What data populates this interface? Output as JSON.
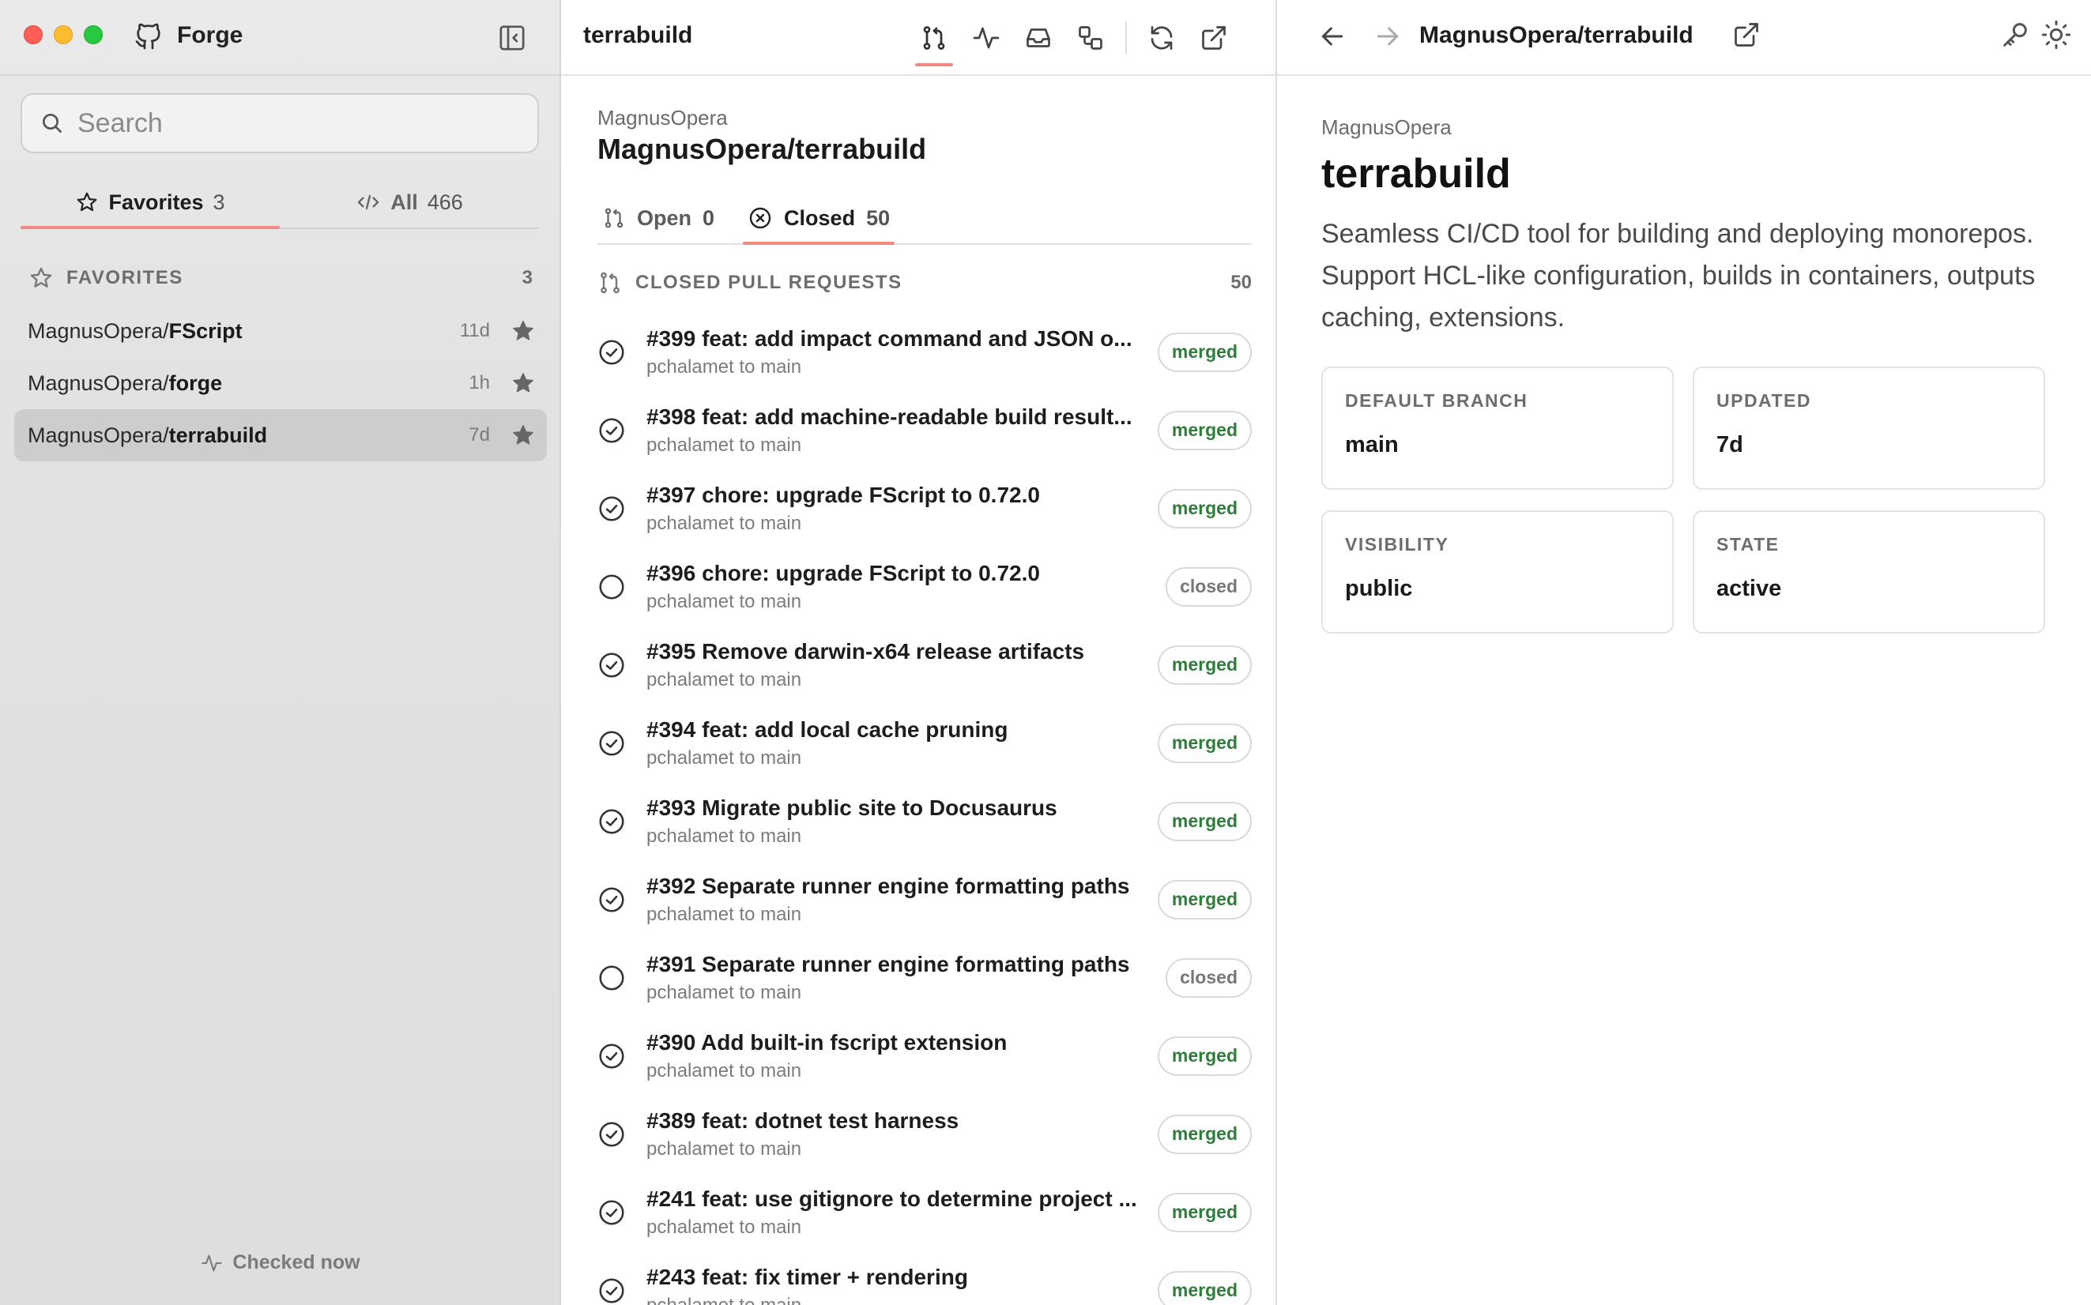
{
  "app": {
    "name": "Forge"
  },
  "sidebar": {
    "search_placeholder": "Search",
    "tabs": [
      {
        "label": "Favorites",
        "count": "3"
      },
      {
        "label": "All",
        "count": "466"
      }
    ],
    "favorites_header": {
      "title": "FAVORITES",
      "count": "3"
    },
    "repos": [
      {
        "owner": "MagnusOpera/",
        "name": "FScript",
        "age": "11d"
      },
      {
        "owner": "MagnusOpera/",
        "name": "forge",
        "age": "1h"
      },
      {
        "owner": "MagnusOpera/",
        "name": "terrabuild",
        "age": "7d"
      }
    ],
    "status": "Checked now"
  },
  "middle": {
    "title": "terrabuild",
    "owner": "MagnusOpera",
    "repo": "MagnusOpera/terrabuild",
    "tabs": [
      {
        "label": "Open",
        "count": "0"
      },
      {
        "label": "Closed",
        "count": "50"
      }
    ],
    "list_header": {
      "title": "CLOSED PULL REQUESTS",
      "count": "50"
    },
    "pull_requests": [
      {
        "title": "#399 feat: add impact command and JSON o...",
        "sub": "pchalamet to main",
        "status": "merged"
      },
      {
        "title": "#398 feat: add machine-readable build result...",
        "sub": "pchalamet to main",
        "status": "merged"
      },
      {
        "title": "#397 chore: upgrade FScript to 0.72.0",
        "sub": "pchalamet to main",
        "status": "merged"
      },
      {
        "title": "#396 chore: upgrade FScript to 0.72.0",
        "sub": "pchalamet to main",
        "status": "closed"
      },
      {
        "title": "#395 Remove darwin-x64 release artifacts",
        "sub": "pchalamet to main",
        "status": "merged"
      },
      {
        "title": "#394 feat: add local cache pruning",
        "sub": "pchalamet to main",
        "status": "merged"
      },
      {
        "title": "#393 Migrate public site to Docusaurus",
        "sub": "pchalamet to main",
        "status": "merged"
      },
      {
        "title": "#392 Separate runner engine formatting paths",
        "sub": "pchalamet to main",
        "status": "merged"
      },
      {
        "title": "#391 Separate runner engine formatting paths",
        "sub": "pchalamet to main",
        "status": "closed"
      },
      {
        "title": "#390 Add built-in fscript extension",
        "sub": "pchalamet to main",
        "status": "merged"
      },
      {
        "title": "#389 feat: dotnet test harness",
        "sub": "pchalamet to main",
        "status": "merged"
      },
      {
        "title": "#241 feat: use gitignore to determine project ...",
        "sub": "pchalamet to main",
        "status": "merged"
      },
      {
        "title": "#243 feat: fix timer + rendering",
        "sub": "pchalamet to main",
        "status": "merged"
      }
    ]
  },
  "right": {
    "path": "MagnusOpera/terrabuild",
    "owner": "MagnusOpera",
    "name": "terrabuild",
    "description": "Seamless CI/CD tool for building and deploying monorepos. Support HCL-like configuration, builds in containers, outputs caching, extensions.",
    "cards": [
      {
        "key": "DEFAULT BRANCH",
        "value": "main"
      },
      {
        "key": "UPDATED",
        "value": "7d"
      },
      {
        "key": "VISIBILITY",
        "value": "public"
      },
      {
        "key": "STATE",
        "value": "active"
      }
    ]
  },
  "colors": {
    "accent": "#f08a80",
    "merged": "#2e7d3a",
    "traffic_red": "#ff5f57",
    "traffic_yellow": "#febc2e",
    "traffic_green": "#28c840"
  }
}
